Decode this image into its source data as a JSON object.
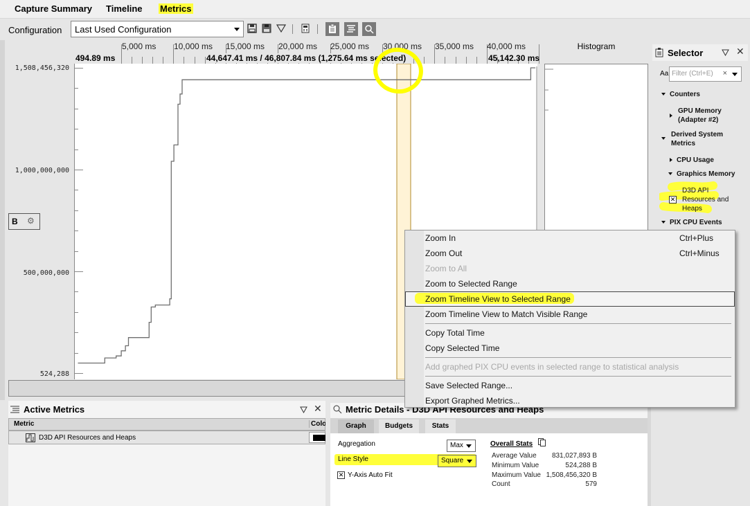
{
  "tabs": [
    {
      "label": "Capture Summary"
    },
    {
      "label": "Timeline"
    },
    {
      "label": "Metrics",
      "active": true
    }
  ],
  "toolbar": {
    "config_label": "Configuration",
    "config_value": "Last Used Configuration",
    "icons": [
      "save-icon",
      "save-as-icon",
      "filter-icon",
      "calculator-icon",
      "clipboard-icon",
      "list-icon",
      "search-icon"
    ]
  },
  "ruler": {
    "ticks": [
      "5,000 ms",
      "10,000 ms",
      "15,000 ms",
      "20,000 ms",
      "25,000 ms",
      "30,000 ms",
      "35,000 ms",
      "40,000 ms"
    ],
    "start": "494.89 ms",
    "selection": "44,647.41 ms / 46,807.84 ms (1,275.64 ms selected)",
    "end": "45,142.30 ms"
  },
  "graph": {
    "y_labels": [
      "1,508,456,320",
      "1,000,000,000",
      "500,000,000",
      "524,288"
    ],
    "b_label": "B",
    "histogram_label": "Histogram",
    "line_color": "#6e6e6e",
    "selection_color": "#fff3d6"
  },
  "chart_data": {
    "type": "line",
    "title": "D3D API Resources and Heaps",
    "ylabel": "B",
    "ylim": [
      524288,
      1508456320
    ],
    "y_ticks": [
      524288,
      500000000,
      1000000000,
      1508456320
    ],
    "x_unit": "ms",
    "xlim": [
      494.89,
      45142.3
    ],
    "line_style": "step",
    "series": [
      {
        "name": "D3D API Resources and Heaps",
        "points": [
          [
            800,
            60000000
          ],
          [
            3400,
            60000000
          ],
          [
            3400,
            85000000
          ],
          [
            4500,
            85000000
          ],
          [
            4500,
            95000000
          ],
          [
            5000,
            95000000
          ],
          [
            5000,
            120000000
          ],
          [
            5400,
            120000000
          ],
          [
            5400,
            145000000
          ],
          [
            5700,
            145000000
          ],
          [
            5700,
            185000000
          ],
          [
            7700,
            185000000
          ],
          [
            7700,
            260000000
          ],
          [
            7900,
            260000000
          ],
          [
            7900,
            335000000
          ],
          [
            8300,
            335000000
          ],
          [
            8300,
            345000000
          ],
          [
            9700,
            345000000
          ],
          [
            9700,
            375000000
          ],
          [
            9850,
            375000000
          ],
          [
            9850,
            1050000000
          ],
          [
            10100,
            1050000000
          ],
          [
            10100,
            1130000000
          ],
          [
            10500,
            1130000000
          ],
          [
            10500,
            1330000000
          ],
          [
            10700,
            1330000000
          ],
          [
            10700,
            1380000000
          ],
          [
            10900,
            1380000000
          ],
          [
            10900,
            1450000000
          ],
          [
            44700,
            1450000000
          ],
          [
            44700,
            1508456320
          ],
          [
            45142,
            1508456320
          ]
        ]
      }
    ],
    "selection_range_ms": [
      44647.41,
      46807.84
    ]
  },
  "context_menu": {
    "items": [
      {
        "label": "Zoom In",
        "shortcut": "Ctrl+Plus",
        "enabled": true
      },
      {
        "label": "Zoom Out",
        "shortcut": "Ctrl+Minus",
        "enabled": true
      },
      {
        "label": "Zoom to All",
        "shortcut": "",
        "enabled": false
      },
      {
        "label": "Zoom to Selected Range",
        "shortcut": "",
        "enabled": true
      },
      {
        "label": "Zoom Timeline View to Selected Range",
        "shortcut": "",
        "enabled": true,
        "hovered": true
      },
      {
        "label": "Zoom Timeline View to Match Visible Range",
        "shortcut": "",
        "enabled": true
      },
      {
        "label": "Copy Total Time",
        "shortcut": "",
        "enabled": true
      },
      {
        "label": "Copy Selected Time",
        "shortcut": "",
        "enabled": true
      },
      {
        "label": "Add graphed PIX CPU events in selected range to statistical analysis",
        "shortcut": "",
        "enabled": false
      },
      {
        "label": "Save Selected Range...",
        "shortcut": "",
        "enabled": true
      },
      {
        "label": "Export Graphed Metrics...",
        "shortcut": "",
        "enabled": true
      }
    ]
  },
  "selector": {
    "title": "Selector",
    "filter_prefix": "Aa",
    "filter_placeholder": "Filter (Ctrl+E)",
    "tree": [
      {
        "label": "Counters",
        "expanded": true
      },
      {
        "label": "GPU Memory (Adapter #2)",
        "expanded": false
      },
      {
        "label": "Derived System Metrics",
        "expanded": true
      },
      {
        "label": "CPU Usage",
        "expanded": false
      },
      {
        "label": "Graphics Memory",
        "expanded": true
      },
      {
        "label": "D3D API Resources and Heaps",
        "checked": true
      },
      {
        "label": "PIX CPU Events",
        "expanded": true
      }
    ]
  },
  "active_metrics": {
    "title": "Active Metrics",
    "columns": [
      "Metric",
      "Color"
    ],
    "rows": [
      {
        "metric": "D3D API Resources and Heaps",
        "color": "#000000"
      }
    ]
  },
  "metric_details": {
    "title": "Metric Details - D3D API Resources and Heaps",
    "tabs": [
      "Graph",
      "Budgets",
      "Stats"
    ],
    "active_tab": "Graph",
    "aggregation_label": "Aggregation",
    "aggregation_value": "Max",
    "line_style_label": "Line Style",
    "line_style_value": "Square",
    "y_auto_fit_label": "Y-Axis Auto Fit",
    "y_auto_fit_checked": true,
    "overall_stats_label": "Overall Stats",
    "stats": [
      {
        "label": "Average Value",
        "value": "831,027,893 B"
      },
      {
        "label": "Minimum Value",
        "value": "524,288 B"
      },
      {
        "label": "Maximum Value",
        "value": "1,508,456,320 B"
      },
      {
        "label": "Count",
        "value": "579"
      }
    ]
  },
  "annotation_color": "#ffff00"
}
